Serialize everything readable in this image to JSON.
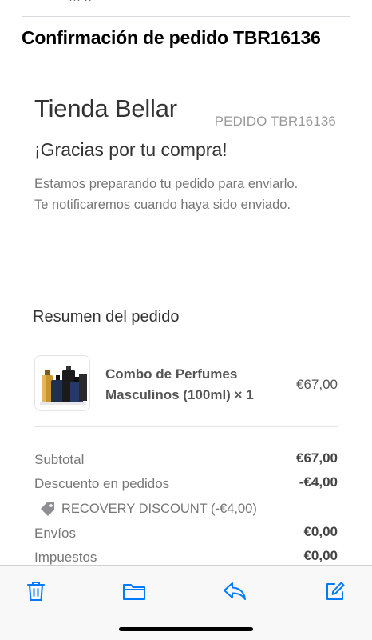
{
  "email": {
    "top_clip_text": "··· ··",
    "subject": "Confirmación de pedido TBR16136"
  },
  "store": {
    "name": "Tienda Bellar",
    "order_label": "PEDIDO TBR16136",
    "thanks": "¡Gracias por tu compra!",
    "message_line1": "Estamos preparando tu pedido para enviarlo.",
    "message_line2": "Te notificaremos cuando haya sido enviado."
  },
  "summary": {
    "title": "Resumen del pedido",
    "product": {
      "name_line1": "Combo de Perfumes",
      "name_line2": "Masculinos (100ml) × 1",
      "price": "€67,00"
    },
    "lines": {
      "subtotal_label": "Subtotal",
      "subtotal_value": "€67,00",
      "discount_label": "Descuento en pedidos",
      "discount_value": "-€4,00",
      "discount_code": "RECOVERY DISCOUNT (-€4,00)",
      "shipping_label": "Envíos",
      "shipping_value": "€0,00",
      "tax_label": "Impuestos",
      "tax_value": "€0,00"
    }
  },
  "toolbar": {
    "icons": [
      "trash-icon",
      "folder-icon",
      "reply-icon",
      "compose-icon"
    ],
    "accent": "#007aff"
  }
}
